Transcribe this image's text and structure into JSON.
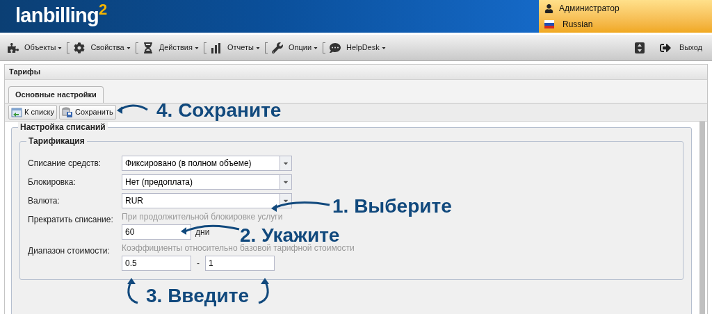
{
  "header": {
    "logo": "lanbilling",
    "logo_sup": "2",
    "user": "Администратор",
    "language": "Russian"
  },
  "menu": [
    {
      "label": "Объекты"
    },
    {
      "label": "Свойства"
    },
    {
      "label": "Действия"
    },
    {
      "label": "Отчеты"
    },
    {
      "label": "Опции"
    },
    {
      "label": "HelpDesk"
    }
  ],
  "logout": "Выход",
  "panel": {
    "title": "Тарифы",
    "tabs": [
      {
        "label": "Основные настройки",
        "selected": true
      }
    ],
    "toolbar": [
      {
        "label": "К списку"
      },
      {
        "label": "Сохранить"
      }
    ],
    "outer_legend": "Настройка списаний",
    "inner_legend": "Тарификация",
    "rows": [
      {
        "kind": "select",
        "label": "Списание средств:",
        "value": "Фиксировано (в полном объеме)"
      },
      {
        "kind": "select",
        "label": "Блокировка:",
        "value": "Нет (предоплата)"
      },
      {
        "kind": "select",
        "label": "Валюта:",
        "value": "RUR"
      },
      {
        "kind": "number",
        "label": "Прекратить списание:",
        "hint": "При продолжительной блокировке услуги",
        "value": "60",
        "unit": "дни"
      },
      {
        "kind": "range",
        "label": "Диапазон стоимости:",
        "hint": "Коэффициенты относительно базовой тарифной стоимости",
        "from": "0.5",
        "separator": "-",
        "to": "1"
      }
    ]
  },
  "annotations": [
    {
      "text": "4. Сохраните"
    },
    {
      "text": "1. Выберите"
    },
    {
      "text": "2. Укажите"
    },
    {
      "text": "3. Введите"
    }
  ]
}
